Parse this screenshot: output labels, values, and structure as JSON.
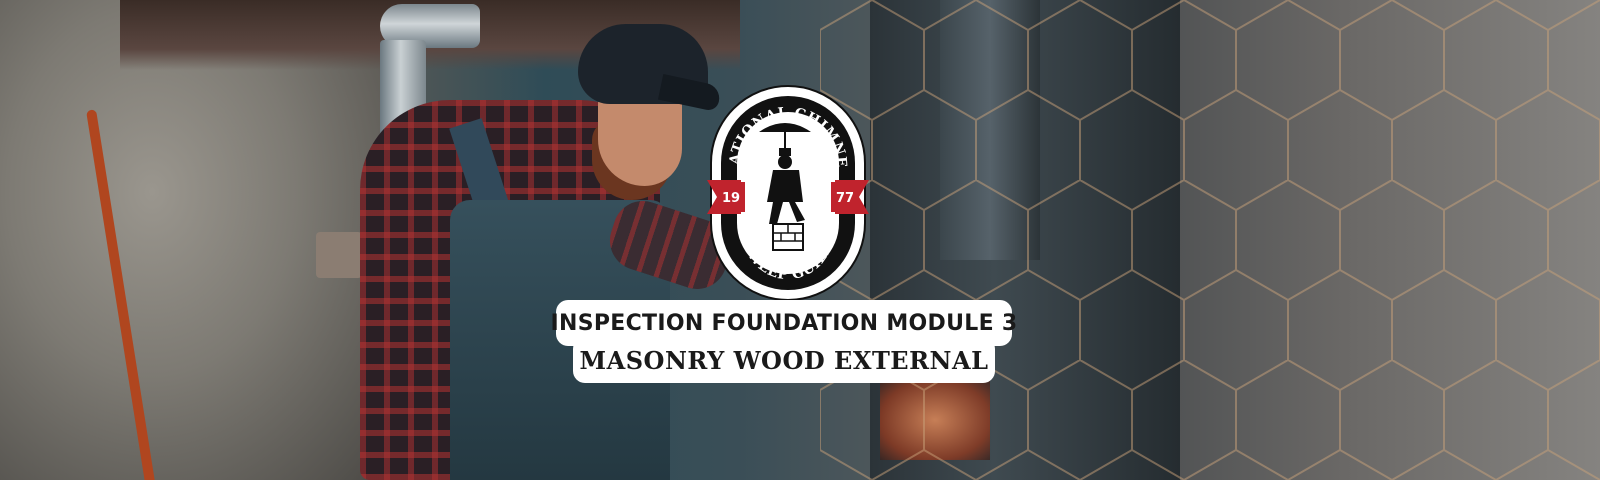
{
  "banner": {
    "logo": {
      "top_text": "NATIONAL CHIMNEY",
      "bottom_text": "SWEEP GUILD",
      "year_left": "19",
      "year_right": "77",
      "colors": {
        "outline": "#111111",
        "ribbon": "#c0232d",
        "badge": "#ffffff"
      }
    },
    "title_line_1": "INSPECTION FOUNDATION MODULE 3",
    "title_line_2": "MASONRY WOOD EXTERNAL"
  }
}
